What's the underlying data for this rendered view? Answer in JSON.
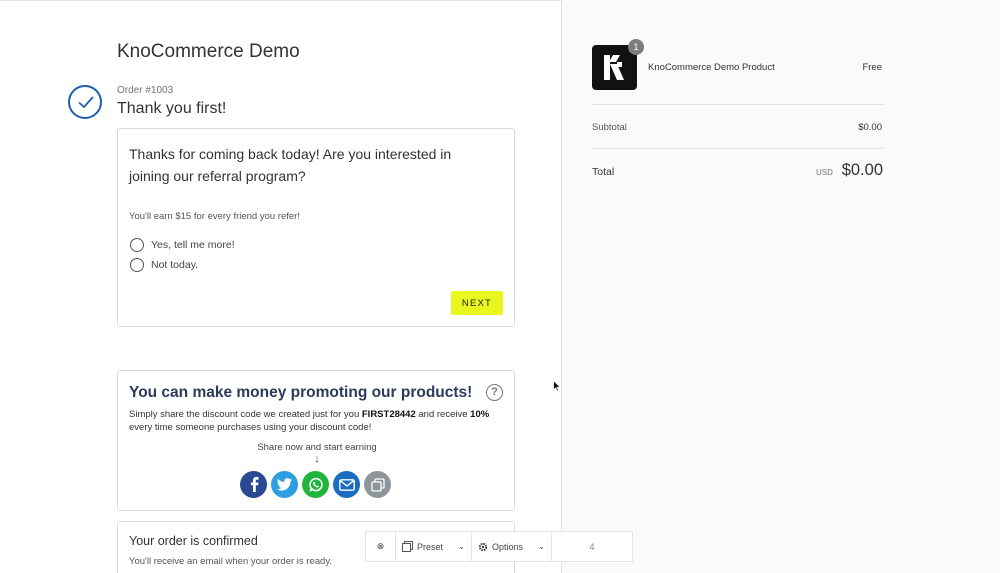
{
  "store": {
    "name": "KnoCommerce Demo"
  },
  "order": {
    "number": "Order #1003",
    "title": "Thank you first!"
  },
  "survey": {
    "question": "Thanks for coming back today! Are you interested in joining our referral program?",
    "subtitle": "You'll earn $15 for every friend you refer!",
    "options": [
      "Yes, tell me more!",
      "Not today."
    ],
    "next_label": "NEXT"
  },
  "promo": {
    "title": "You can make money promoting our products!",
    "help_glyph": "?",
    "text_1": "Simply share the discount code we created just for you ",
    "code": "FIRST28442",
    "text_2": " and receive ",
    "percent": "10%",
    "text_3": " every time someone purchases using your discount code!",
    "share_label": "Share now and start earning",
    "share_arrow": "↓"
  },
  "confirmation": {
    "title": "Your order is confirmed",
    "subtitle": "You'll receive an email when your order is ready."
  },
  "cart": {
    "quantity": "1",
    "product_name": "KnoCommerce Demo Product",
    "product_price": "Free",
    "subtotal_label": "Subtotal",
    "subtotal_value": "$0.00",
    "total_label": "Total",
    "currency": "USD",
    "total_value": "$0.00"
  },
  "toolbar": {
    "close_glyph": "⊗",
    "preset_label": "Preset",
    "options_label": "Options",
    "page_value": "4",
    "chevron": "⌄"
  },
  "colors": {
    "accent_blue": "#1f5ea8",
    "next_button": "#e8f71d",
    "promo_title": "#2c3a5c",
    "facebook": "#2b4a94",
    "twitter": "#2d9fe0",
    "whatsapp": "#22b53c",
    "email": "#1c6dbf",
    "copy": "#8e959b"
  },
  "icons": [
    "check-icon",
    "help-icon",
    "facebook-icon",
    "twitter-icon",
    "whatsapp-icon",
    "email-icon",
    "copy-icon",
    "close-icon",
    "preset-icon",
    "gear-icon",
    "cursor-icon"
  ]
}
